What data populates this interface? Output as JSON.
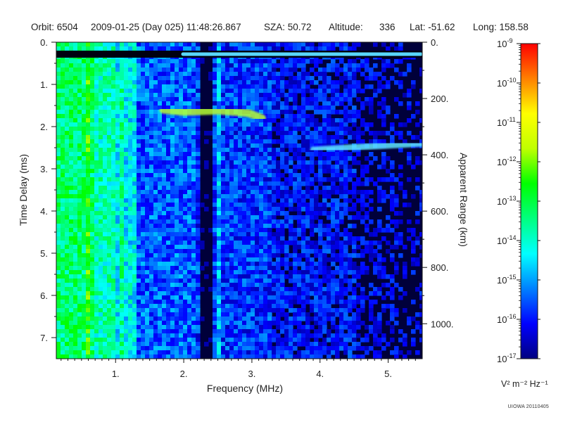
{
  "header": {
    "orbit": "Orbit: 6504",
    "datetime": "2009-01-25 (Day 025) 11:48:26.867",
    "sza": "SZA:  50.72",
    "altitude_label": "Altitude:",
    "altitude_value": "336",
    "lat": "Lat: -51.62",
    "long": "Long: 158.58"
  },
  "footer": {
    "credit": "UIOWA 20110405"
  },
  "chart_data": {
    "type": "heatmap",
    "title": "",
    "xlabel": "Frequency (MHz)",
    "ylabel": "Time Delay (ms)",
    "y2label": "Apparent Range (km)",
    "xlim": [
      0.13,
      5.5
    ],
    "ylim": [
      0,
      7.5
    ],
    "y_inverted": true,
    "grid": false,
    "x_ticks": [
      1,
      2,
      3,
      4,
      5
    ],
    "x_tick_labels": [
      "1.",
      "2.",
      "3.",
      "4.",
      "5."
    ],
    "y_ticks": [
      0,
      1,
      2,
      3,
      4,
      5,
      6,
      7
    ],
    "y_tick_labels": [
      "0.",
      "1.",
      "2.",
      "3.",
      "4.",
      "5.",
      "6.",
      "7."
    ],
    "range_ticks_km": [
      0,
      200,
      400,
      600,
      800,
      1000
    ],
    "range_tick_labels": [
      "0.",
      "200.",
      "400.",
      "600.",
      "800.",
      "1000."
    ],
    "colorbar": {
      "scale": "log",
      "min_exp": -17,
      "max_exp": -9,
      "tick_exps": [
        -9,
        -10,
        -11,
        -12,
        -13,
        -14,
        -15,
        -16,
        -17
      ],
      "unit": "V² m⁻² Hz⁻¹",
      "colors": [
        "#000080",
        "#0000ff",
        "#0080ff",
        "#00ffff",
        "#00ff80",
        "#00ff00",
        "#c0ff00",
        "#ffff00",
        "#ff8000",
        "#ff0000"
      ]
    },
    "features": [
      {
        "kind": "ionospheric-echo",
        "points": [
          [
            1.7,
            1.6
          ],
          [
            2.0,
            1.65
          ],
          [
            2.5,
            1.62
          ],
          [
            2.95,
            1.68
          ],
          [
            3.15,
            1.8
          ]
        ]
      },
      {
        "kind": "surface-reflection",
        "points": [
          [
            3.9,
            2.55
          ],
          [
            4.4,
            2.5
          ],
          [
            5.5,
            2.4
          ]
        ]
      },
      {
        "kind": "noise-spike-line",
        "x": 2.52
      },
      {
        "kind": "data-gap",
        "x_range": [
          2.25,
          2.4
        ]
      }
    ]
  }
}
